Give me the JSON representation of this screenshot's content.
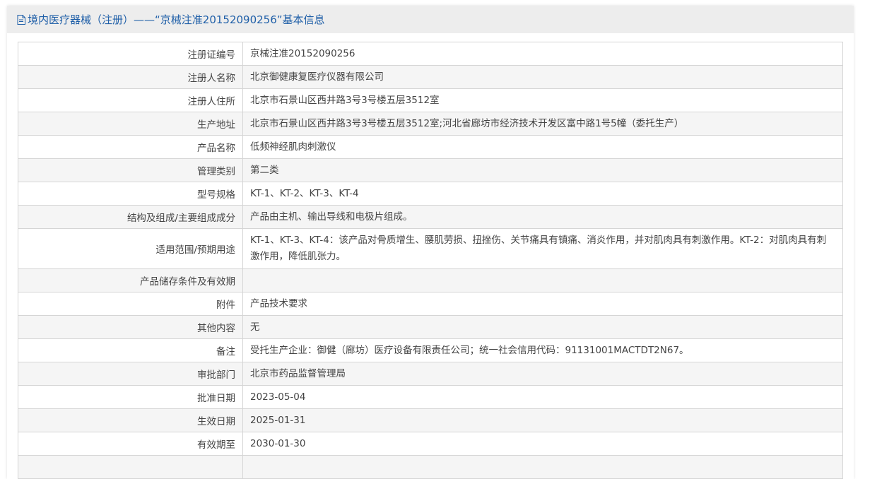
{
  "header": {
    "title": "境内医疗器械（注册）——“京械注准20152090256”基本信息",
    "icon": "document-icon",
    "color": "#1f5fa8"
  },
  "rows": [
    {
      "label": "注册证编号",
      "value": "京械注准20152090256"
    },
    {
      "label": "注册人名称",
      "value": "北京御健康复医疗仪器有限公司"
    },
    {
      "label": "注册人住所",
      "value": "北京市石景山区西井路3号3号楼五层3512室"
    },
    {
      "label": "生产地址",
      "value": "北京市石景山区西井路3号3号楼五层3512室;河北省廊坊市经济技术开发区富中路1号5幢（委托生产）"
    },
    {
      "label": "产品名称",
      "value": "低频神经肌肉刺激仪"
    },
    {
      "label": "管理类别",
      "value": "第二类"
    },
    {
      "label": "型号规格",
      "value": "KT-1、KT-2、KT-3、KT-4"
    },
    {
      "label": "结构及组成/主要组成成分",
      "value": "产品由主机、输出导线和电极片组成。"
    },
    {
      "label": "适用范围/预期用途",
      "value": "KT-1、KT-3、KT-4：该产品对骨质增生、腰肌劳损、扭挫伤、关节痛具有镇痛、消炎作用，并对肌肉具有刺激作用。KT-2：对肌肉具有刺激作用，降低肌张力。"
    },
    {
      "label": "产品储存条件及有效期",
      "value": ""
    },
    {
      "label": "附件",
      "value": "产品技术要求"
    },
    {
      "label": "其他内容",
      "value": "无"
    },
    {
      "label": "备注",
      "value": "受托生产企业：御健（廊坊）医疗设备有限责任公司；统一社会信用代码：91131001MACTDT2N67。"
    },
    {
      "label": "审批部门",
      "value": "北京市药品监督管理局"
    },
    {
      "label": "批准日期",
      "value": "2023-05-04"
    },
    {
      "label": "生效日期",
      "value": "2025-01-31"
    },
    {
      "label": "有效期至",
      "value": "2030-01-30"
    },
    {
      "label": "",
      "value": ""
    }
  ]
}
